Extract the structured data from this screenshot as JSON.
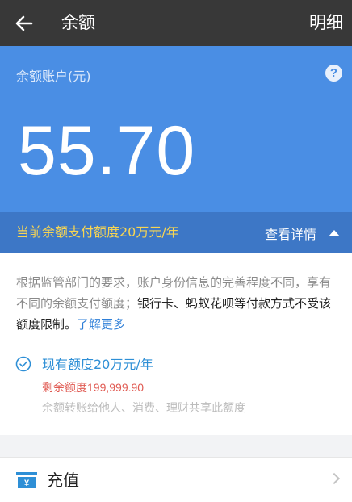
{
  "header": {
    "title": "余额",
    "detail_label": "明细",
    "back_icon": "arrow-left-icon"
  },
  "balance": {
    "account_label": "余额账户(元)",
    "amount": "55.70",
    "help_glyph": "?"
  },
  "limit_bar": {
    "text": "当前余额支付额度20万元/年",
    "view_detail": "查看详情"
  },
  "info": {
    "desc_part1": "根据监管部门的要求，账户身份信息的完善程度不同，享有不同的余额支付额度；",
    "desc_part2": "银行卡、蚂蚁花呗等付款方式不受该额度限制。",
    "learn_more": "了解更多",
    "quota": "现有额度20万元/年",
    "remaining_label": "剩余额度",
    "remaining_value": "199,999.90",
    "share_note": "余额转账给他人、消费、理财共享此额度"
  },
  "recharge": {
    "label": "充值"
  },
  "colors": {
    "header_bg": "#383838",
    "balance_bg": "#4a8ee4",
    "limit_bar_bg": "#3d77c6",
    "limit_text": "#f7d553",
    "link_blue": "#2e7fd8",
    "remaining_red": "#e05a52"
  }
}
